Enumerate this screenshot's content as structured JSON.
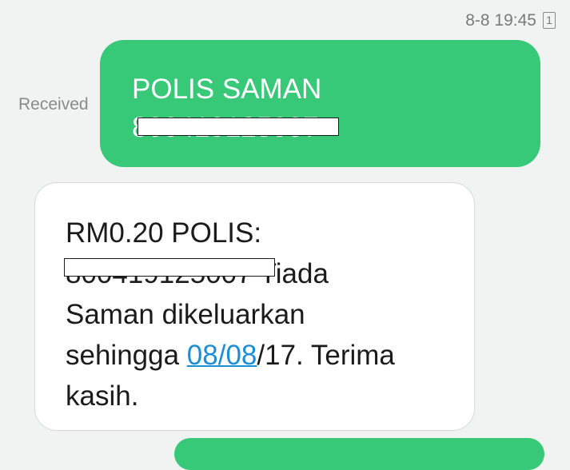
{
  "header": {
    "timestamp": "8-8 19:45",
    "sim_badge": "1"
  },
  "sent_message": {
    "status_label": "Received",
    "line1": "POLIS SAMAN",
    "line2_redacted": "800419125007"
  },
  "received_message": {
    "line1": "RM0.20 POLIS:",
    "line2_redacted": "800419125007",
    "line2_rest": " Tiada",
    "line3": "Saman dikeluarkan",
    "line4_prefix": "sehingga ",
    "line4_link": "08/08",
    "line4_suffix": "/17. Terima",
    "line5": "kasih."
  },
  "colors": {
    "sent_bubble": "#37c878",
    "received_bubble": "#ffffff",
    "link": "#1b8ed6",
    "background": "#f1f2f2"
  }
}
